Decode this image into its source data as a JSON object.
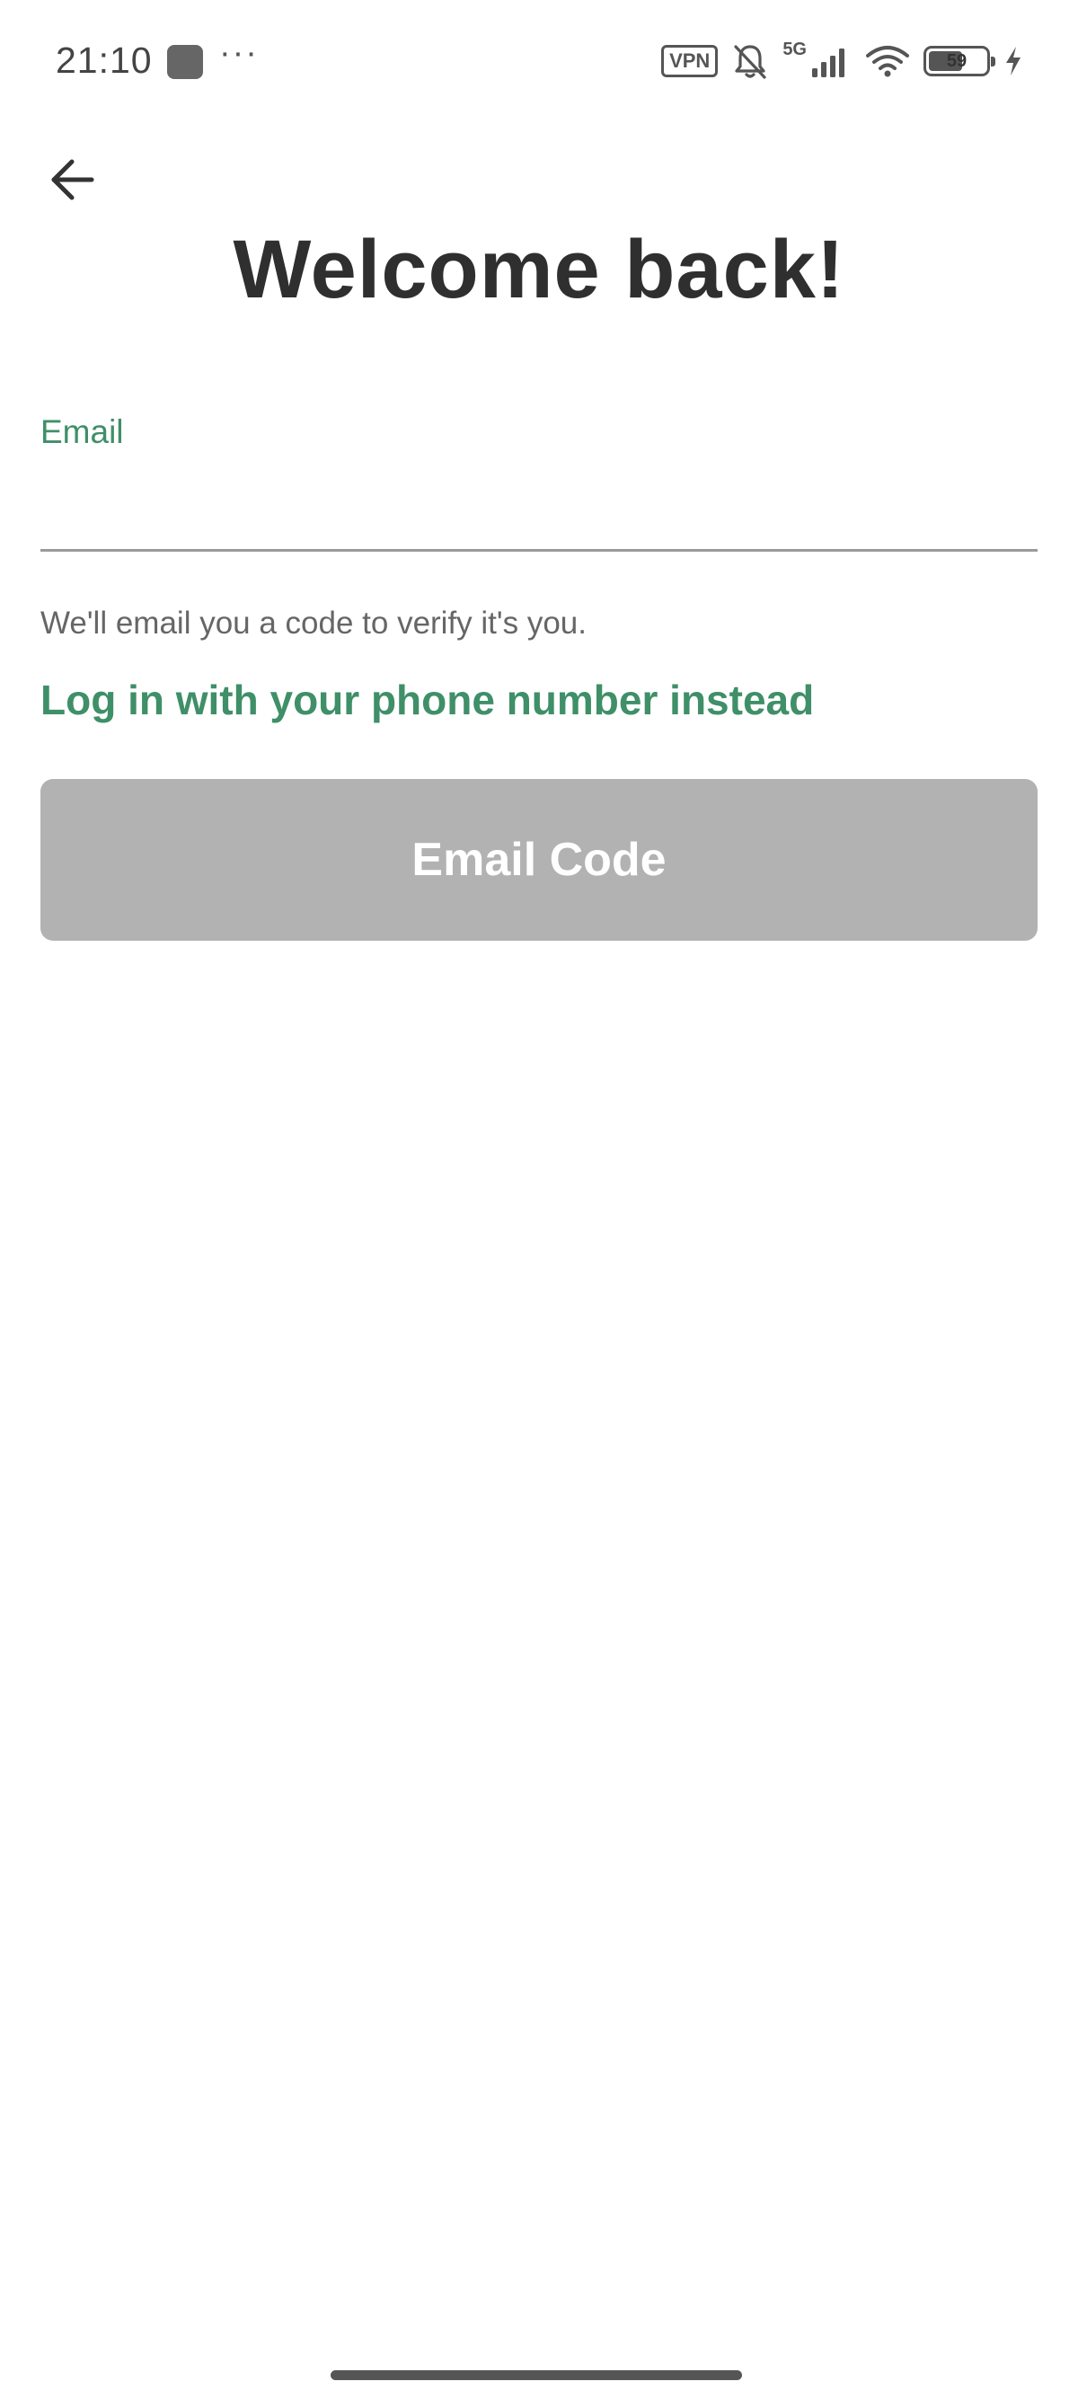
{
  "status_bar": {
    "time": "21:10",
    "more": "···",
    "vpn": "VPN",
    "network": "5G",
    "battery_level": "59",
    "icons": [
      "app-notification-icon",
      "vpn-icon",
      "mute-bell-icon",
      "signal-icon",
      "wifi-icon",
      "battery-icon",
      "charging-icon"
    ]
  },
  "header": {
    "back_icon": "arrow-left-icon"
  },
  "main": {
    "title": "Welcome back!",
    "email_label": "Email",
    "email_value": "",
    "email_placeholder": "",
    "helper_text": "We'll email you a code to verify it's you.",
    "phone_link": "Log in with your phone number instead",
    "submit_label": "Email Code"
  },
  "colors": {
    "accent": "#3f8f68",
    "title": "#2f2f2f",
    "button_disabled": "#b2b2b2",
    "divider": "#9a9a9a"
  }
}
